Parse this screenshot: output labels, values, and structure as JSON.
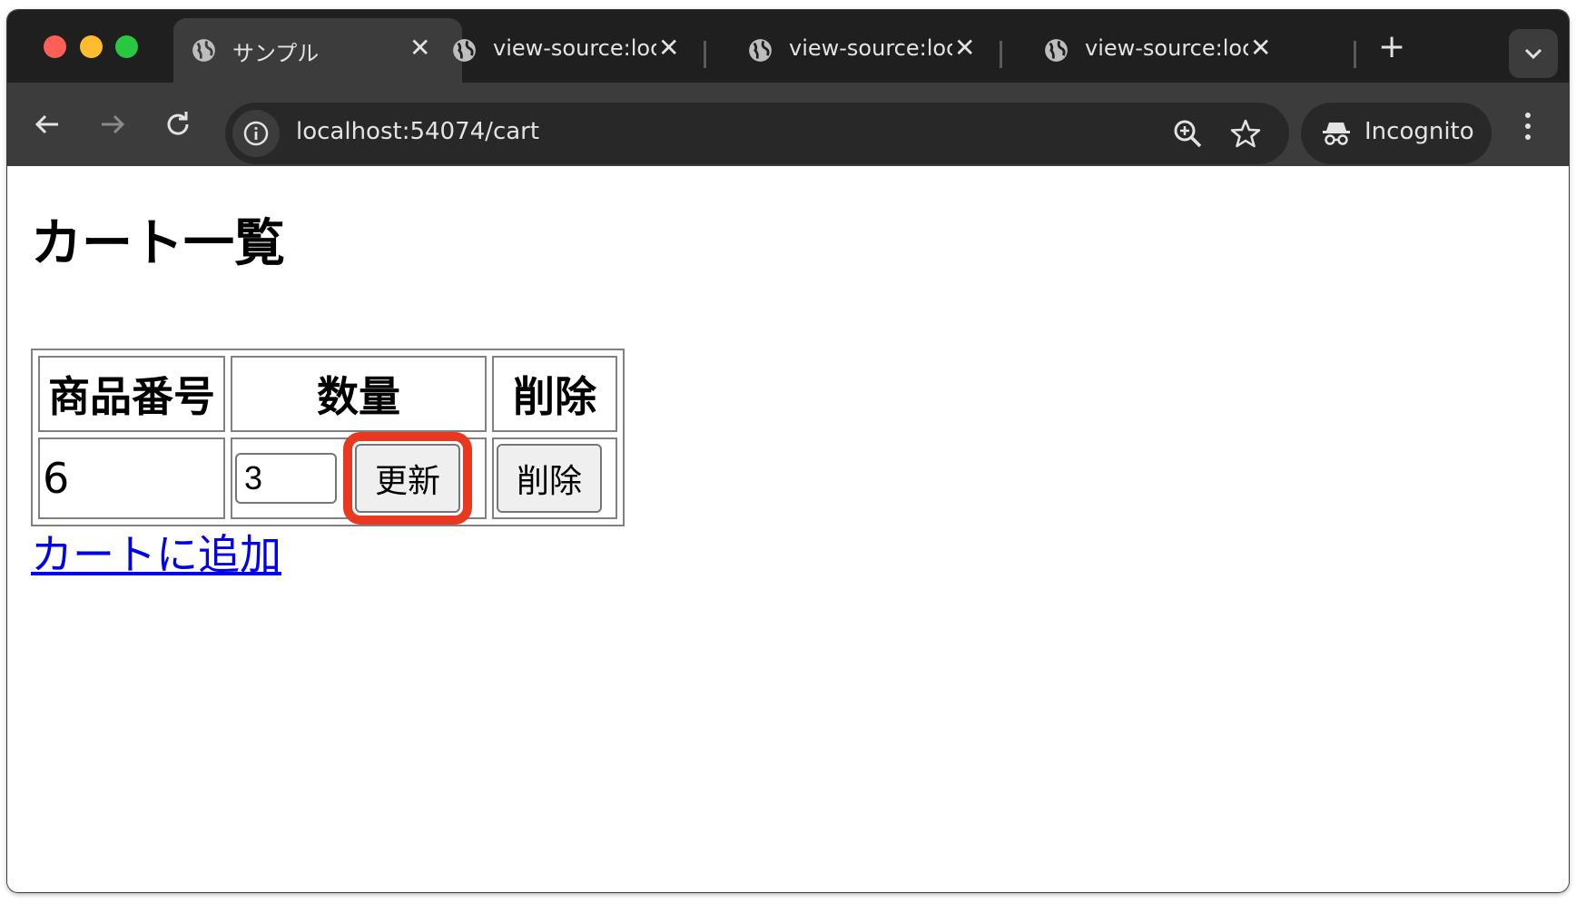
{
  "browser": {
    "tabs": [
      {
        "title": "サンプル"
      },
      {
        "title": "view-source:loc"
      },
      {
        "title": "view-source:loc"
      },
      {
        "title": "view-source:loc"
      }
    ],
    "address": "localhost:54074/cart",
    "incognito_label": "Incognito"
  },
  "page": {
    "heading": "カート一覧",
    "table": {
      "headers": [
        "商品番号",
        "数量",
        "削除"
      ],
      "rows": [
        {
          "product_id": "6",
          "quantity": "3",
          "update_label": "更新",
          "delete_label": "削除"
        }
      ]
    },
    "add_link": "カートに追加"
  },
  "highlight_color": "#e8381f"
}
